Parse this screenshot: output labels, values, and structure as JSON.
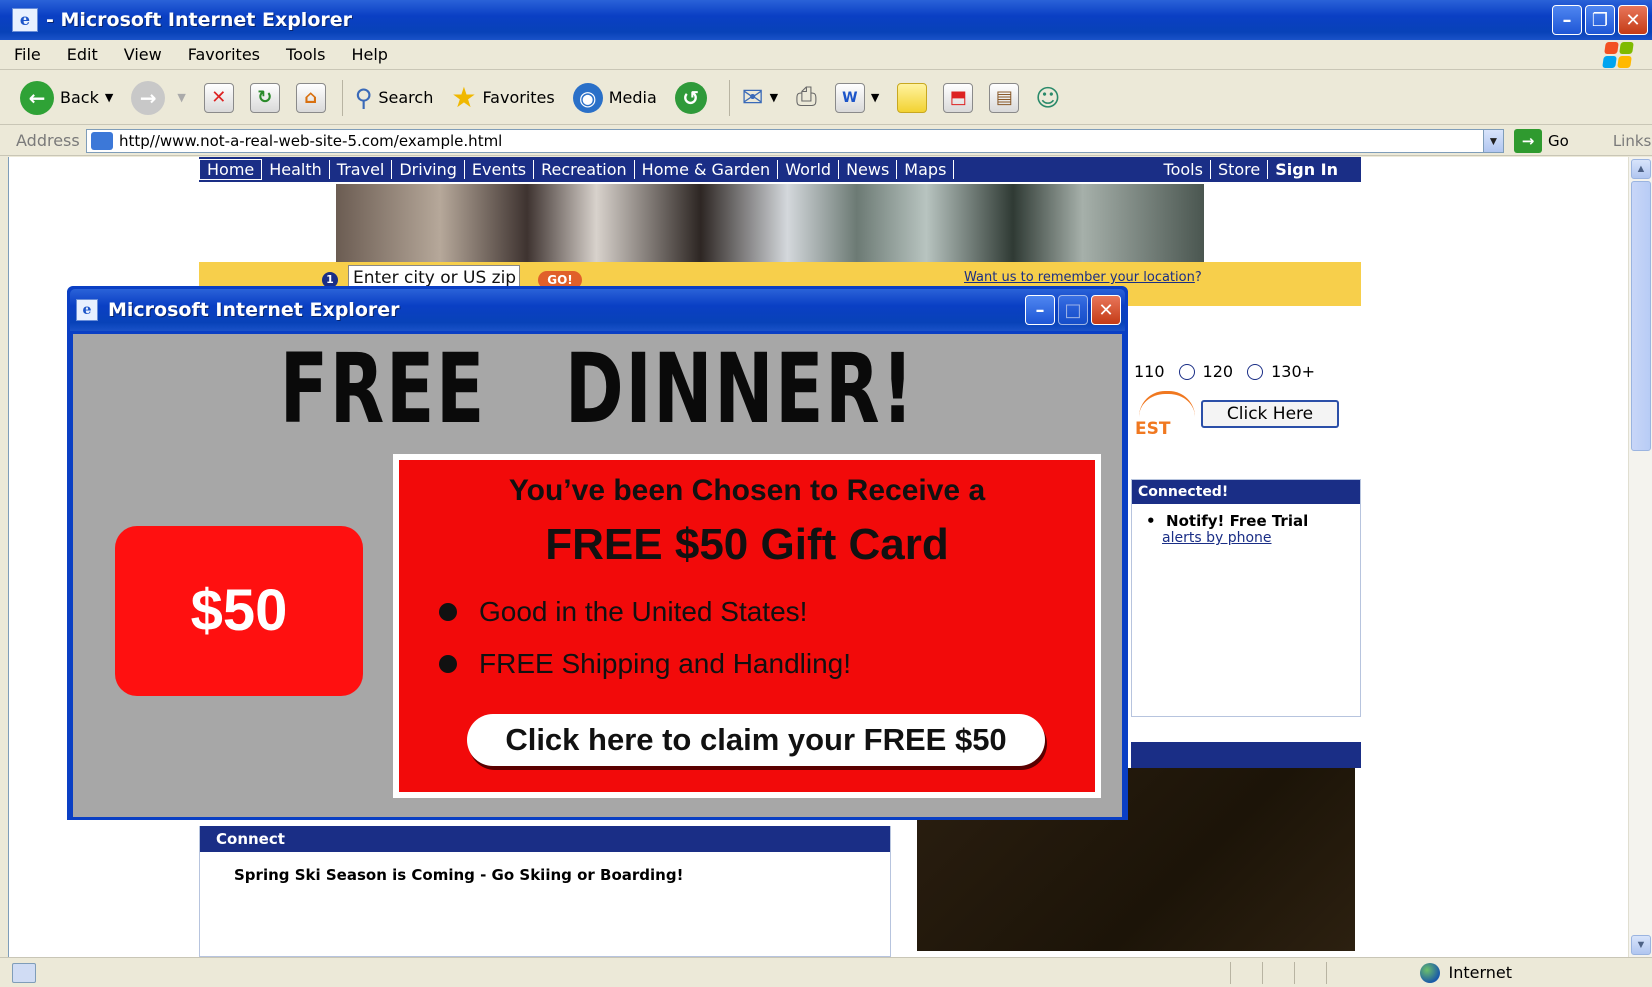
{
  "window": {
    "title": "- Microsoft Internet Explorer"
  },
  "menu": [
    "File",
    "Edit",
    "View",
    "Favorites",
    "Tools",
    "Help"
  ],
  "toolbar": {
    "back": "Back",
    "search": "Search",
    "favorites": "Favorites",
    "media": "Media"
  },
  "address": {
    "label": "Address",
    "url": "http//www.not-a-real-web-site-5.com/example.html",
    "go": "Go",
    "links": "Links"
  },
  "site": {
    "nav_left": [
      "Home",
      "Health",
      "Travel",
      "Driving",
      "Events",
      "Recreation",
      "Home & Garden",
      "World",
      "News",
      "Maps"
    ],
    "nav_right": [
      "Tools",
      "Store",
      "Sign In"
    ],
    "location_num": "1",
    "location_input": "Enter city or US zip",
    "location_go": "GO!",
    "remember_link": "Want us to remember your location",
    "remember_q": "?",
    "poll_options": [
      "110",
      "120",
      "130+"
    ],
    "poll_button": "Click Here",
    "test_word": "EST",
    "connected_title": "Connected!",
    "connected_item": "Notify! Free Trial",
    "connected_link": "alerts by phone",
    "connect_title": "Connect",
    "connect_text": "Spring Ski Season is Coming - Go Skiing or Boarding!"
  },
  "popup": {
    "title": "Microsoft Internet Explorer",
    "headline": "FREE   DINNER!",
    "badge": "$50",
    "line1": "You’ve been Chosen to Receive a",
    "line2": "FREE $50 Gift Card",
    "bullet1": "Good in the United States!",
    "bullet2": "FREE Shipping and Handling!",
    "cta": "Click here to claim your FREE $50"
  },
  "status": {
    "zone": "Internet"
  },
  "colors": {
    "accent": "#1a2e86",
    "popup_red": "#f20a0a",
    "yellow": "#f7cf4b"
  }
}
